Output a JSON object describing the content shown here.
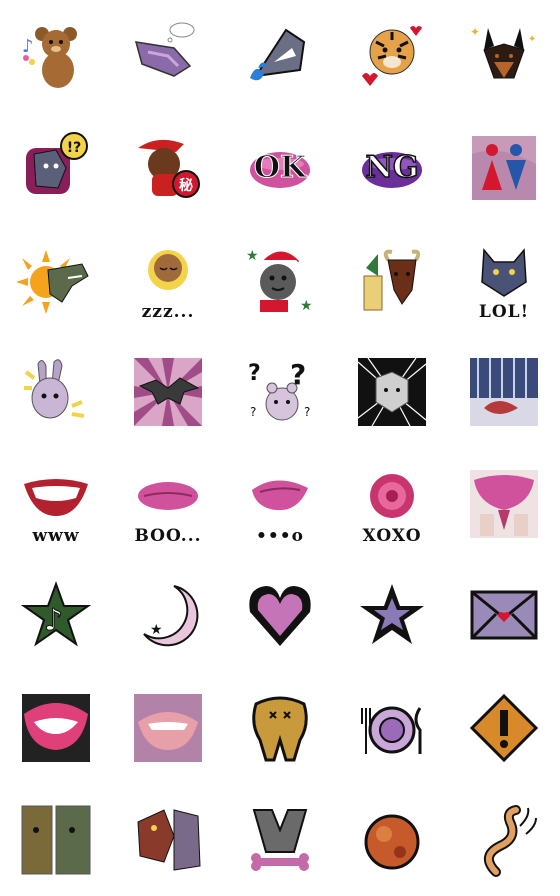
{
  "stickers": {
    "r3c3": "OK",
    "r3c4": "NG",
    "r2c2": "秘",
    "r2c1": "!?",
    "r4c2": "zzz...",
    "r4c5": "LOL!",
    "r5c3a": "?",
    "r5c3b": "?",
    "r6c1": "www",
    "r6c2": "BOO...",
    "r6c3": "•••o",
    "r6c4": "XOXO"
  },
  "colors": {
    "pink": "#d0529c",
    "purple": "#7a3ea8",
    "lavender": "#c9a7d8",
    "black": "#111111",
    "orange": "#f5a21c",
    "red": "#d2172f",
    "green": "#2f7a3a",
    "gold": "#c89a3c",
    "brown": "#8a5a2b"
  },
  "icons": [
    "teddy-bear-music-icon",
    "dinosaur-thought-bubble-icon",
    "shark-splash-icon",
    "tiger-hearts-icon",
    "doberman-sparkle-icon",
    "wolf-surprise-icon",
    "bear-red-hat-secret-icon",
    "ok-lips-icon",
    "ng-lips-icon",
    "restroom-icon",
    "dinosaur-sun-icon",
    "bear-sleeping-icon",
    "santa-bear-icon",
    "new-year-ox-icon",
    "wolf-lol-icon",
    "rabbit-shock-icon",
    "bat-sunburst-icon",
    "bear-question-icon",
    "wolf-speedlines-icon",
    "fish-stripes-icon",
    "grin-lips-icon",
    "boo-lips-icon",
    "pursed-lips-icon",
    "rose-kiss-icon",
    "flower-skirt-icon",
    "music-star-icon",
    "crescent-moon-icon",
    "heart-icon",
    "star-icon",
    "love-letter-icon",
    "open-lips-icon",
    "biting-lips-icon",
    "tooth-icon",
    "dinner-plate-icon",
    "warning-sign-icon",
    "reptile-pair-icon",
    "lizard-face-icon",
    "skull-bone-icon",
    "round-globe-icon",
    "ear-swirl-icon"
  ]
}
